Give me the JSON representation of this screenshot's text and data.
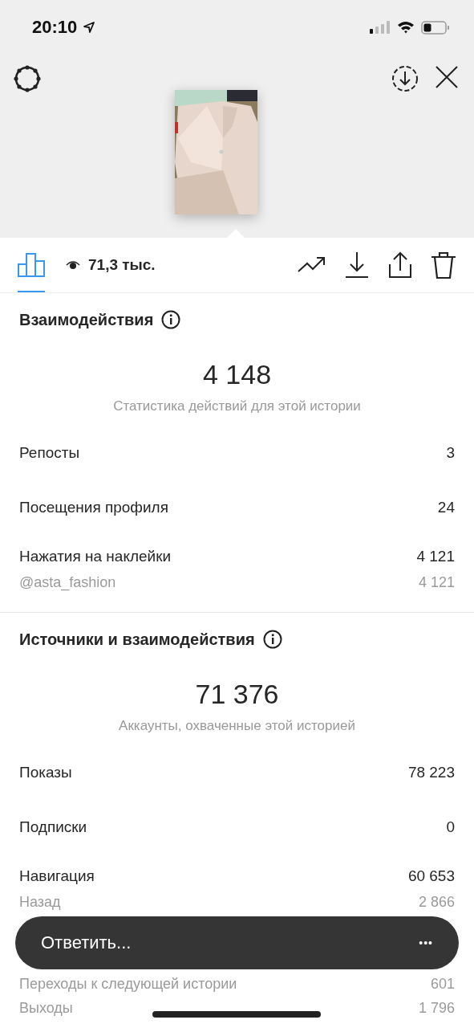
{
  "status_bar": {
    "time": "20:10"
  },
  "toolbar": {
    "views": "71,3 тыс.",
    "tabs": [
      {
        "kind": "insights",
        "selected": true
      }
    ]
  },
  "sections": [
    {
      "title": "Взаимодействия",
      "total": "4 148",
      "caption": "Статистика действий для этой истории",
      "rows": [
        {
          "label": "Репосты",
          "value": "3",
          "sub": []
        },
        {
          "label": "Посещения профиля",
          "value": "24",
          "sub": []
        },
        {
          "label": "Нажатия на наклейки",
          "value": "4 121",
          "sub": [
            {
              "label": "@asta_fashion",
              "value": "4 121"
            }
          ]
        }
      ]
    },
    {
      "title": "Источники и взаимодействия",
      "total": "71 376",
      "caption": "Аккаунты, охваченные этой историей",
      "rows": [
        {
          "label": "Показы",
          "value": "78 223",
          "sub": []
        },
        {
          "label": "Подписки",
          "value": "0",
          "sub": []
        },
        {
          "label": "Навигация",
          "value": "60 653",
          "sub": [
            {
              "label": "Назад",
              "value": "2 866"
            },
            {
              "kind": "covered"
            },
            {
              "label": "Переходы к следующей истории",
              "value": "601"
            },
            {
              "label": "Выходы",
              "value": "1 796"
            }
          ]
        }
      ]
    }
  ],
  "reply_bar": {
    "placeholder": "Ответить...",
    "more": "•••"
  }
}
